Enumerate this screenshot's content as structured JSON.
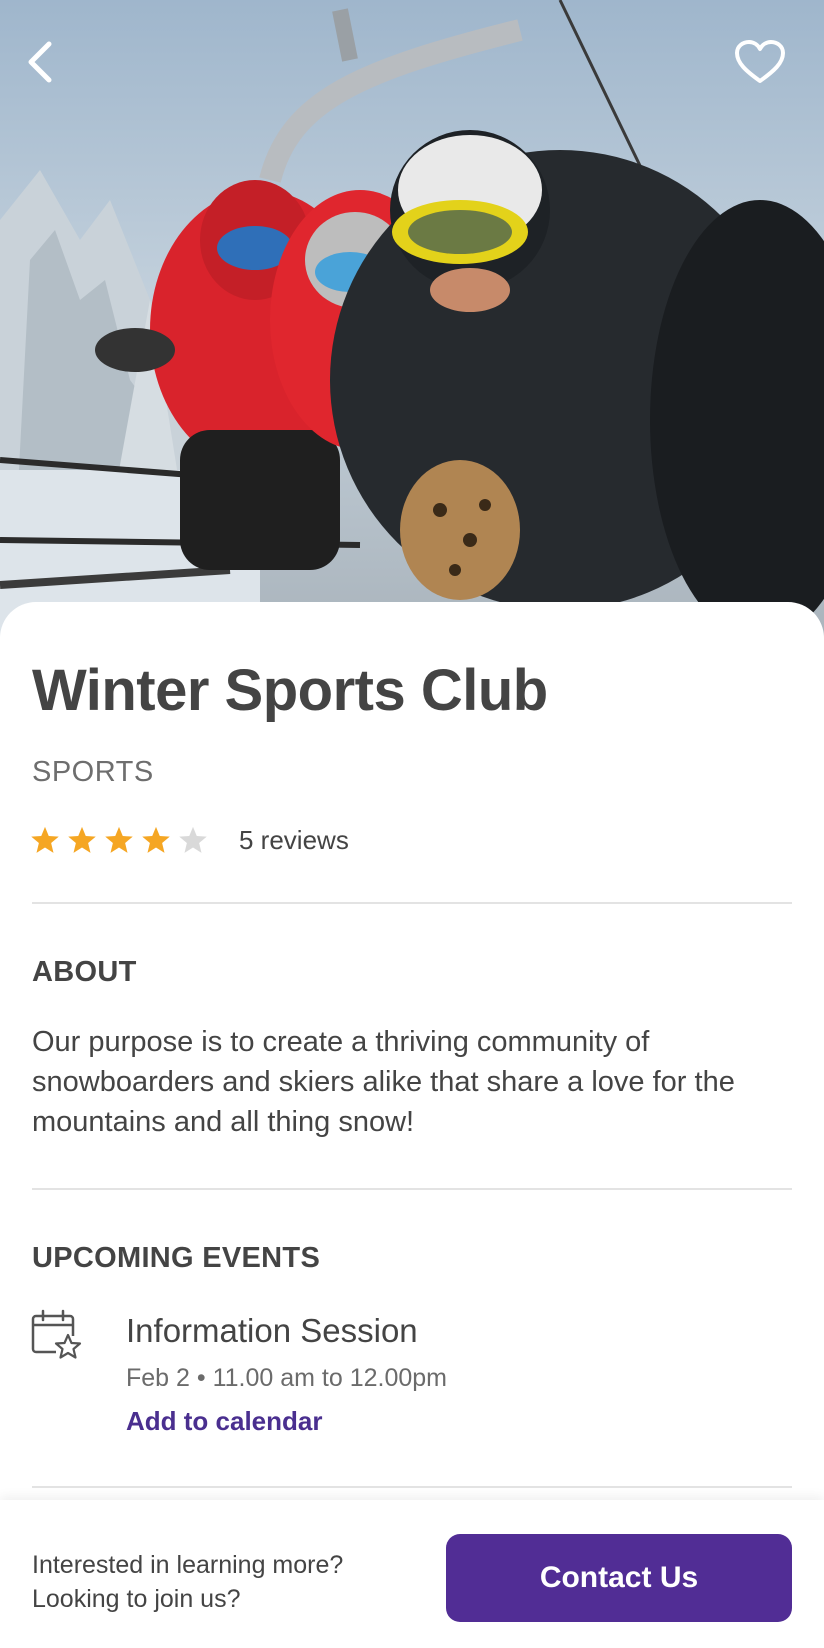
{
  "hero": {
    "image_alt": "Three skiers in goggles and helmets on a chairlift",
    "back_icon": "chevron-left-icon",
    "favorite_icon": "heart-outline-icon"
  },
  "club": {
    "title": "Winter Sports Club",
    "category": "SPORTS",
    "rating": 4,
    "rating_max": 5,
    "reviews_label": "5 reviews"
  },
  "about": {
    "heading": "ABOUT",
    "text": "Our purpose is to create a thriving community of snowboarders and skiers alike that share a love for the mountains and all thing snow!"
  },
  "events": {
    "heading": "UPCOMING EVENTS",
    "items": [
      {
        "icon": "calendar-star-icon",
        "title": "Information Session",
        "when": "Feb 2 • 11.00 am to 12.00pm",
        "action": "Add to calendar"
      }
    ]
  },
  "footer": {
    "line1": "Interested in learning more?",
    "line2": "Looking to join us?",
    "button": "Contact Us"
  },
  "colors": {
    "accent": "#512d95",
    "link": "#4a2f8f",
    "star_filled": "#f5a623",
    "star_empty": "#d9d9d9",
    "text": "#444444"
  }
}
